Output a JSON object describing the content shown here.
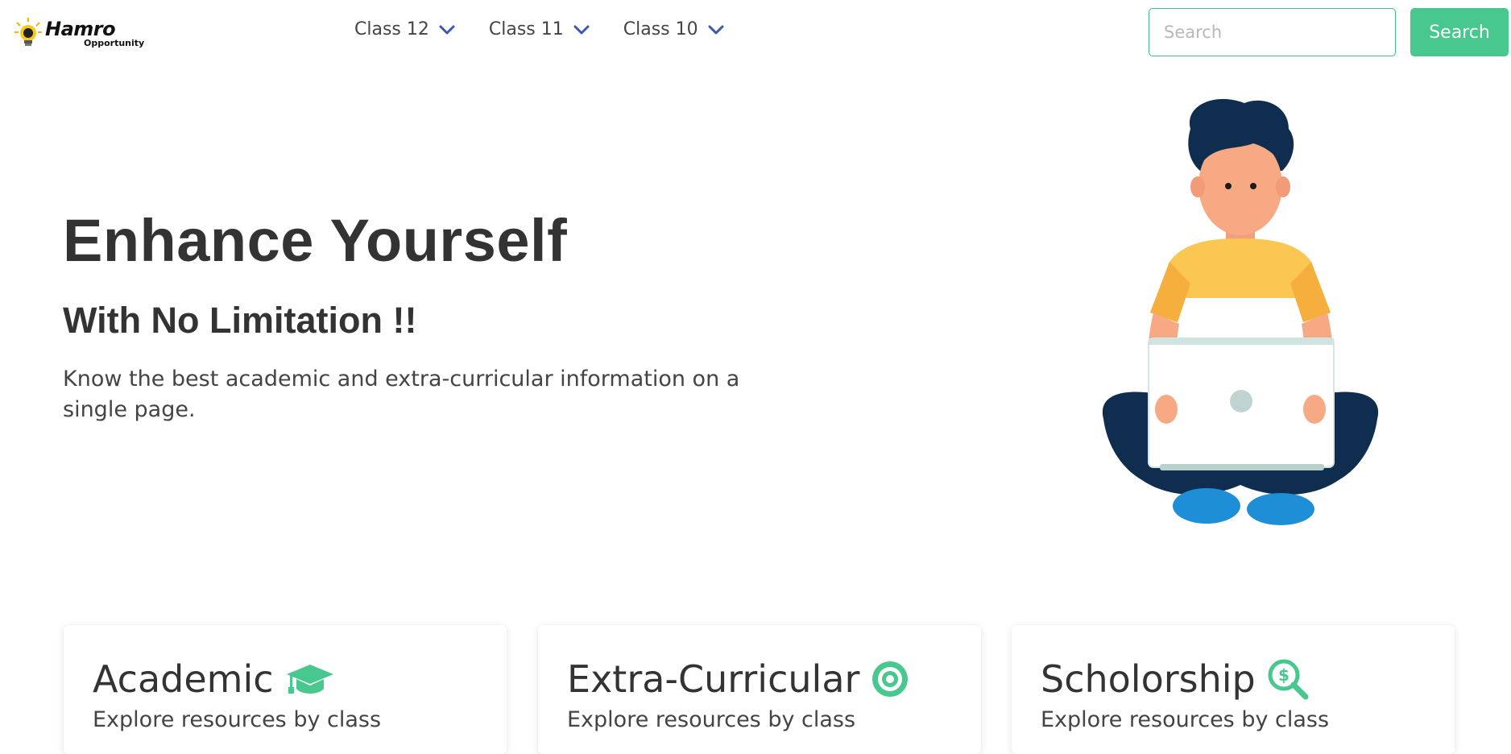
{
  "brand": {
    "name": "Hamro",
    "tagline": "Opportunity"
  },
  "nav": {
    "items": [
      {
        "label": "Class 12"
      },
      {
        "label": "Class 11"
      },
      {
        "label": "Class 10"
      }
    ]
  },
  "search": {
    "placeholder": "Search",
    "value": "",
    "button_label": "Search"
  },
  "hero": {
    "title": "Enhance Yourself",
    "subtitle": "With No Limitation !!",
    "description": "Know the best academic and extra-curricular information on a single page."
  },
  "cards": [
    {
      "title": "Academic",
      "subtitle": "Explore resources by class",
      "icon": "graduation-cap-icon"
    },
    {
      "title": "Extra-Curricular",
      "subtitle": "Explore resources by class",
      "icon": "target-icon"
    },
    {
      "title": "Scholorship",
      "subtitle": "Explore resources by class",
      "icon": "dollar-search-icon"
    }
  ],
  "colors": {
    "accent": "#48c78e",
    "nav_chevron": "#3d56b2",
    "text": "#333333"
  }
}
